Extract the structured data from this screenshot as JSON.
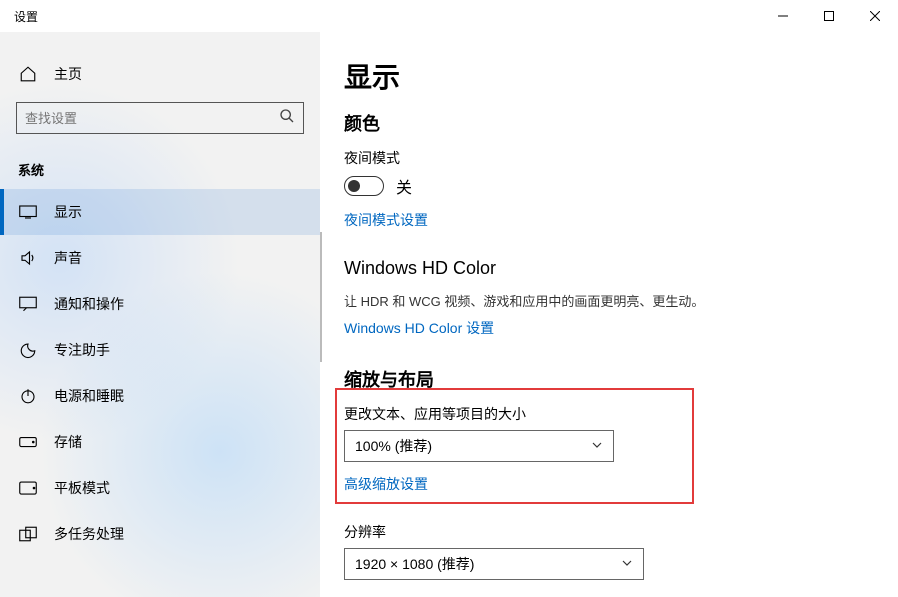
{
  "window": {
    "title": "设置"
  },
  "sidebar": {
    "home": "主页",
    "search_placeholder": "查找设置",
    "section": "系统",
    "items": [
      {
        "label": "显示"
      },
      {
        "label": "声音"
      },
      {
        "label": "通知和操作"
      },
      {
        "label": "专注助手"
      },
      {
        "label": "电源和睡眠"
      },
      {
        "label": "存储"
      },
      {
        "label": "平板模式"
      },
      {
        "label": "多任务处理"
      }
    ]
  },
  "page": {
    "title": "显示",
    "color_heading": "颜色",
    "night_light_label": "夜间模式",
    "toggle_off": "关",
    "night_light_link": "夜间模式设置",
    "hdcolor_heading": "Windows HD Color",
    "hdcolor_desc": "让 HDR 和 WCG 视频、游戏和应用中的画面更明亮、更生动。",
    "hdcolor_link": "Windows HD Color 设置",
    "scale_heading": "缩放与布局",
    "scale_label": "更改文本、应用等项目的大小",
    "scale_value": "100% (推荐)",
    "scale_link": "高级缩放设置",
    "resolution_label": "分辨率",
    "resolution_value": "1920 × 1080 (推荐)"
  }
}
